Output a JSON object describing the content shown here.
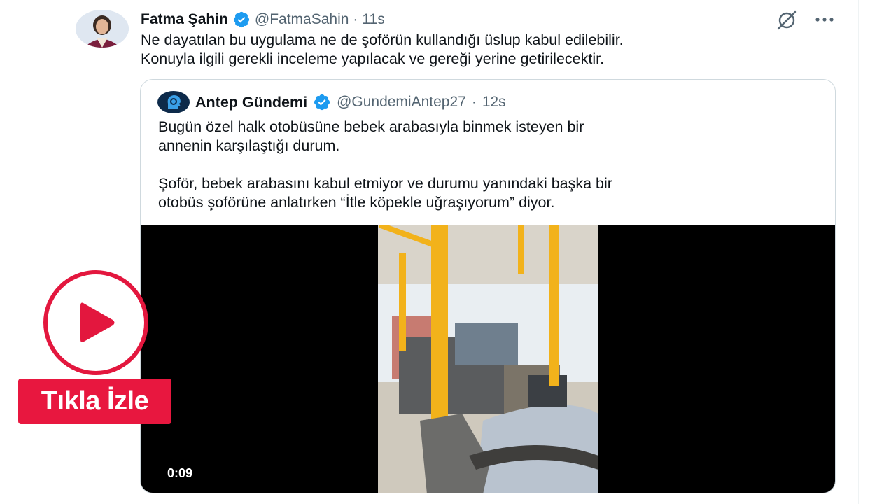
{
  "tweet": {
    "author_name": "Fatma Şahin",
    "handle": "@FatmaSahin",
    "separator": "·",
    "time": "11s",
    "text_line1": "Ne dayatılan bu uygulama ne de şoförün kullandığı üslup kabul edilebilir.",
    "text_line2": "Konuyla ilgili gerekli inceleme yapılacak ve gereği yerine getirilecektir."
  },
  "quote": {
    "author_name": "Antep Gündemi",
    "handle": "@GundemiAntep27",
    "separator": "·",
    "time": "12s",
    "paragraph1_line1": "Bugün özel halk otobüsüne bebek arabasıyla binmek isteyen bir",
    "paragraph1_line2": "annenin karşılaştığı durum.",
    "paragraph2_line1": "Şoför, bebek arabasını kabul etmiyor ve durumu yanındaki başka bir",
    "paragraph2_line2": "otobüs şoförüne anlatırken “İtle köpekle uğraşıyorum” diyor.",
    "video_duration": "0:09"
  },
  "overlay": {
    "cta_label": "Tıkla İzle"
  },
  "icons": {
    "verified": "verified-badge-icon",
    "grok": "slashed-circle-icon",
    "more": "more-options-icon",
    "play": "play-icon"
  },
  "colors": {
    "verified_blue": "#1d9bf0",
    "text_primary": "#0f1419",
    "text_secondary": "#536471",
    "border": "#cfd9de",
    "cta_red": "#e8173f"
  }
}
